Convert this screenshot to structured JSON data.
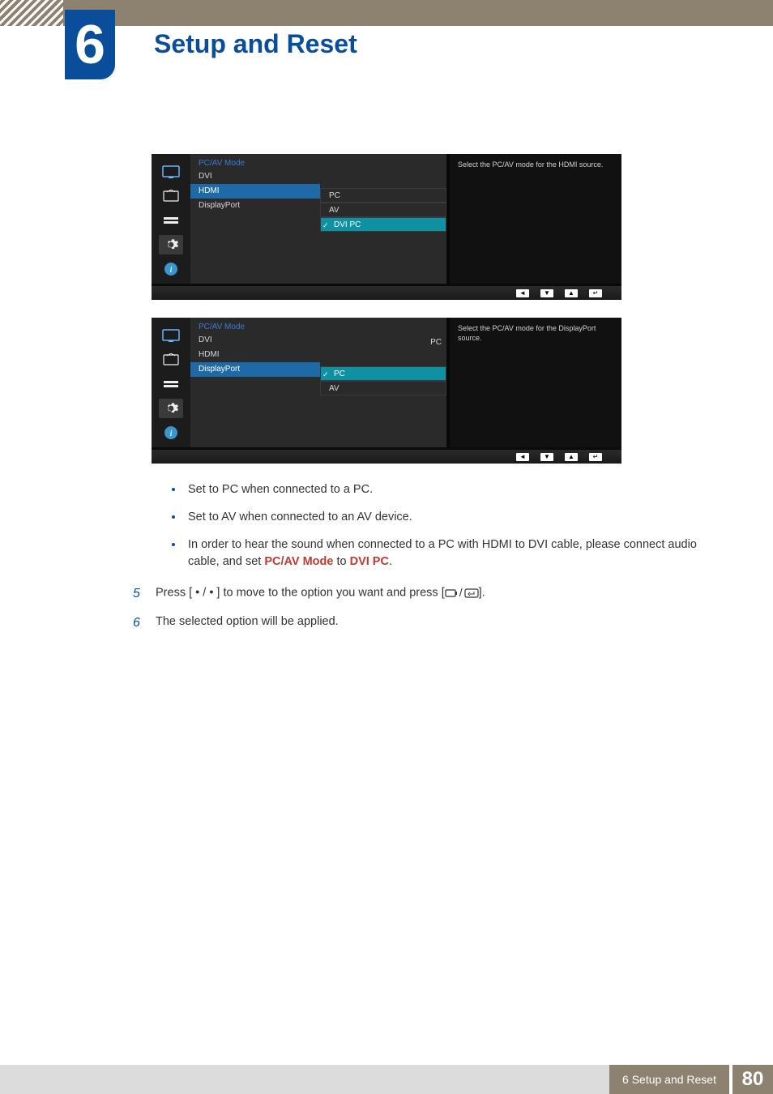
{
  "chapter": {
    "number": "6",
    "title": "Setup and Reset"
  },
  "osd1": {
    "title": "PC/AV Mode",
    "items": [
      "DVI",
      "HDMI",
      "DisplayPort"
    ],
    "selected_index": 1,
    "sub": [
      "PC",
      "AV",
      "DVI PC"
    ],
    "checked_index": 2,
    "help": "Select the PC/AV mode for the HDMI source."
  },
  "osd2": {
    "title": "PC/AV Mode",
    "items": [
      "DVI",
      "HDMI",
      "DisplayPort"
    ],
    "selected_index": 2,
    "current_value": "PC",
    "sub": [
      "PC",
      "AV"
    ],
    "checked_index": 0,
    "help": "Select the PC/AV mode for the DisplayPort source."
  },
  "bullets": {
    "b1": "Set to PC when connected to a PC.",
    "b2": "Set to AV when connected to an AV device.",
    "b3a": "In order to hear the sound when connected to a PC with HDMI to DVI cable, please connect audio cable, and set ",
    "b3_red1": "PC/AV Mode",
    "b3b": " to ",
    "b3_red2": "DVI PC",
    "b3c": "."
  },
  "steps": {
    "s5_num": "5",
    "s5a": "Press [ ",
    "s5_dot": "•",
    "s5_slash": " / ",
    "s5b": " ] to move to the option you want and press [",
    "s5c": "].",
    "s6_num": "6",
    "s6": "The selected option will be applied."
  },
  "footer": {
    "label": "6 Setup and Reset",
    "page": "80"
  }
}
